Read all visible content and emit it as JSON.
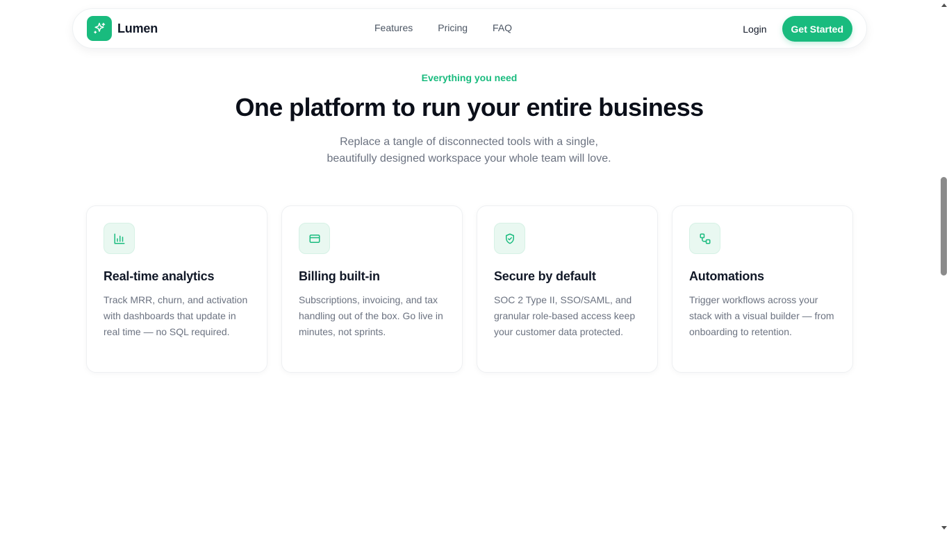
{
  "nav": {
    "brand_name": "Lumen",
    "brand_icon": "sparkles-icon",
    "links": [
      "Features",
      "Pricing",
      "FAQ"
    ],
    "login_label": "Login",
    "cta_label": "Get Started"
  },
  "hero": {
    "eyebrow": "Everything you need",
    "title": "One platform to run your entire business",
    "subtitle_line1": "Replace a tangle of disconnected tools with a single,",
    "subtitle_line2": "beautifully designed workspace your whole team will love."
  },
  "features": [
    {
      "icon": "bar-chart-icon",
      "title": "Real-time analytics",
      "description": "Track MRR, churn, and activation with dashboards that update in real time — no SQL required."
    },
    {
      "icon": "credit-card-icon",
      "title": "Billing built-in",
      "description": "Subscriptions, invoicing, and tax handling out of the box. Go live in minutes, not sprints."
    },
    {
      "icon": "shield-check-icon",
      "title": "Secure by default",
      "description": "SOC 2 Type II, SSO/SAML, and granular role-based access keep your customer data protected."
    },
    {
      "icon": "workflow-icon",
      "title": "Automations",
      "description": "Trigger workflows across your stack with a visual builder — from onboarding to retention."
    }
  ],
  "colors": {
    "accent": "#19bb7e",
    "accent_soft": "#e9f8f1",
    "text_primary": "#111827",
    "text_muted": "#6b7280"
  }
}
